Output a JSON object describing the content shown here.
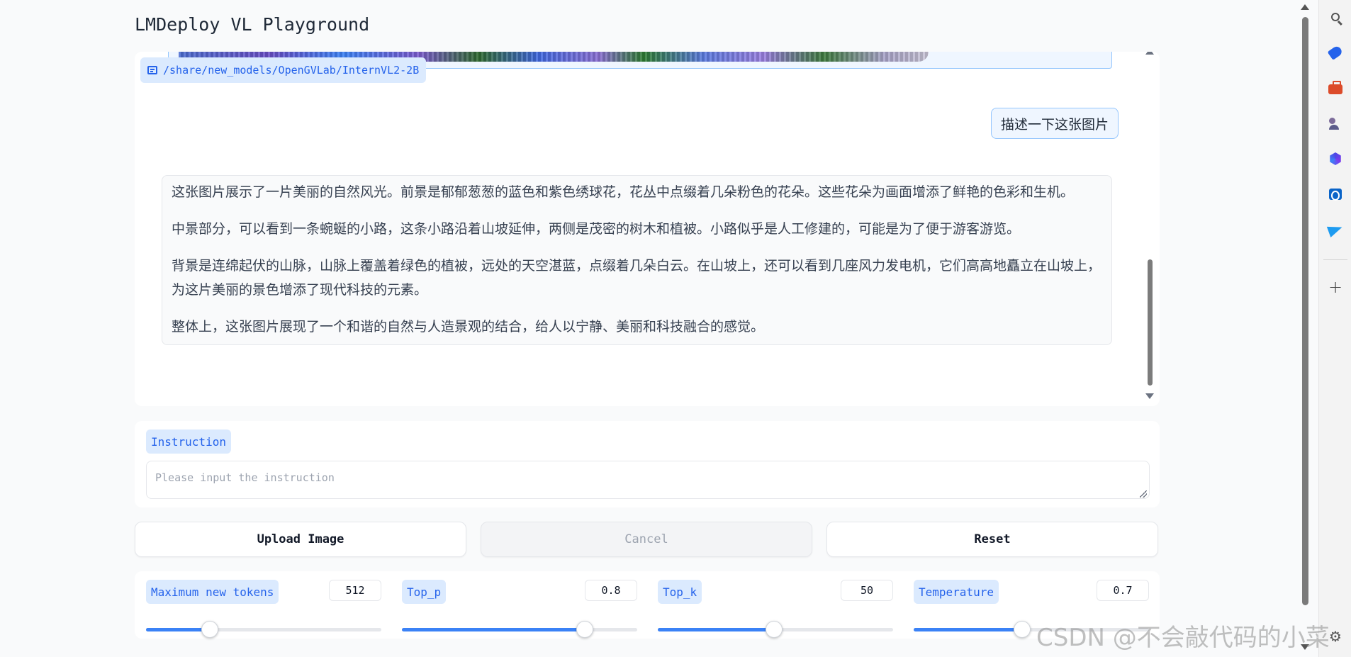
{
  "app": {
    "title": "LMDeploy VL Playground"
  },
  "chat": {
    "model_path": "/share/new_models/OpenGVLab/InternVL2-2B",
    "user_message": "描述一下这张图片",
    "bot_paragraphs": [
      "这张图片展示了一片美丽的自然风光。前景是郁郁葱葱的蓝色和紫色绣球花，花丛中点缀着几朵粉色的花朵。这些花朵为画面增添了鲜艳的色彩和生机。",
      "中景部分，可以看到一条蜿蜒的小路，这条小路沿着山坡延伸，两侧是茂密的树木和植被。小路似乎是人工修建的，可能是为了便于游客游览。",
      "背景是连绵起伏的山脉，山脉上覆盖着绿色的植被，远处的天空湛蓝，点缀着几朵白云。在山坡上，还可以看到几座风力发电机，它们高高地矗立在山坡上，为这片美丽的景色增添了现代科技的元素。",
      "整体上，这张图片展现了一个和谐的自然与人造景观的结合，给人以宁静、美丽和科技融合的感觉。"
    ],
    "accent_color": "#2563eb"
  },
  "instruction": {
    "label": "Instruction",
    "value": "",
    "placeholder": "Please input the instruction"
  },
  "buttons": {
    "upload": "Upload Image",
    "cancel": "Cancel",
    "reset": "Reset"
  },
  "sliders": [
    {
      "label": "Maximum new tokens",
      "value": "512",
      "fraction": 0.27
    },
    {
      "label": "Top_p",
      "value": "0.8",
      "fraction": 0.776
    },
    {
      "label": "Top_k",
      "value": "50",
      "fraction": 0.495
    },
    {
      "label": "Temperature",
      "value": "0.7",
      "fraction": 0.46
    }
  ],
  "rail_icons": [
    "search-icon",
    "tag-icon",
    "briefcase-icon",
    "people-icon",
    "copilot-icon",
    "outlook-icon",
    "send-icon",
    "plus-icon",
    "settings-icon"
  ],
  "watermark": "CSDN @不会敲代码的小菜"
}
